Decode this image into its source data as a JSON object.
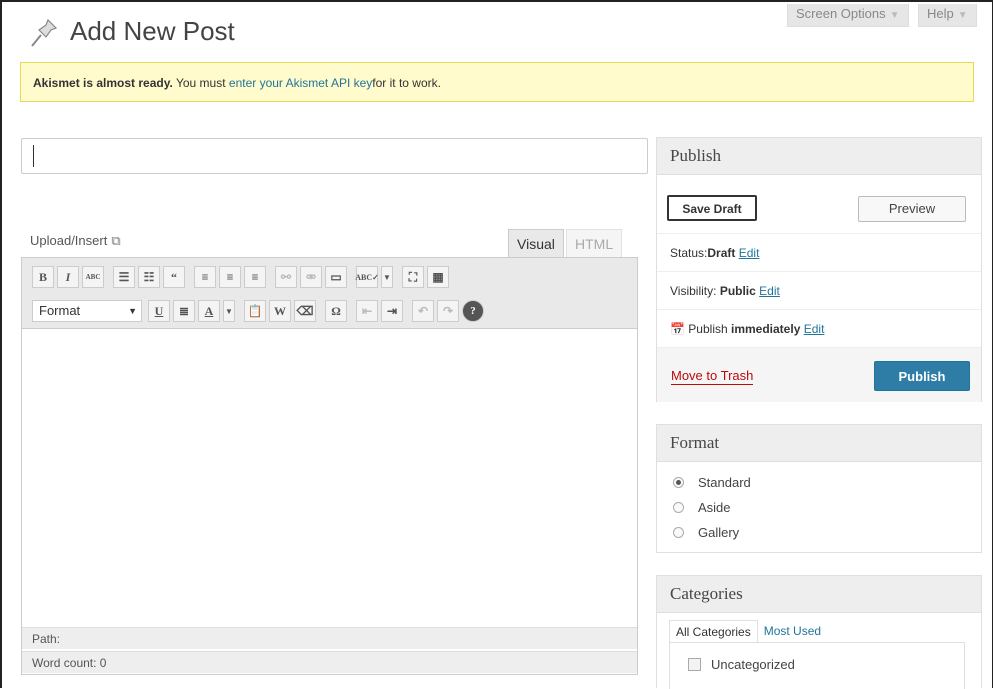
{
  "header": {
    "title": "Add New Post",
    "screen_options": "Screen Options",
    "help": "Help"
  },
  "notice": {
    "bold": "Akismet is almost ready.",
    "text1": " You must ",
    "link": "enter your Akismet API key",
    "text2": "for it to work."
  },
  "post_title": {
    "value": "",
    "placeholder": ""
  },
  "editor": {
    "upload_insert": "Upload/Insert",
    "tab_visual": "Visual",
    "tab_html": "HTML",
    "format_select": "Format",
    "path_label": "Path:",
    "word_count": "Word count: 0"
  },
  "publish_box": {
    "title": "Publish",
    "save_draft": "Save Draft",
    "preview": "Preview",
    "status_label": "Status:",
    "status_value": "Draft",
    "visibility_label": "Visibility:",
    "visibility_value": "Public",
    "publish_label": "Publish",
    "publish_value": "immediately",
    "edit": "Edit",
    "move_to_trash": "Move to Trash",
    "publish_button": "Publish"
  },
  "format_box": {
    "title": "Format",
    "options": [
      "Standard",
      "Aside",
      "Gallery"
    ],
    "selected": "Standard"
  },
  "categories_box": {
    "title": "Categories",
    "tab_all": "All Categories",
    "tab_most_used": "Most Used",
    "items": [
      "Uncategorized"
    ]
  },
  "colors": {
    "link": "#21759b",
    "publish_button": "#2e7da6",
    "notice_bg": "#fffbcc",
    "trash": "#bc0b0b"
  }
}
